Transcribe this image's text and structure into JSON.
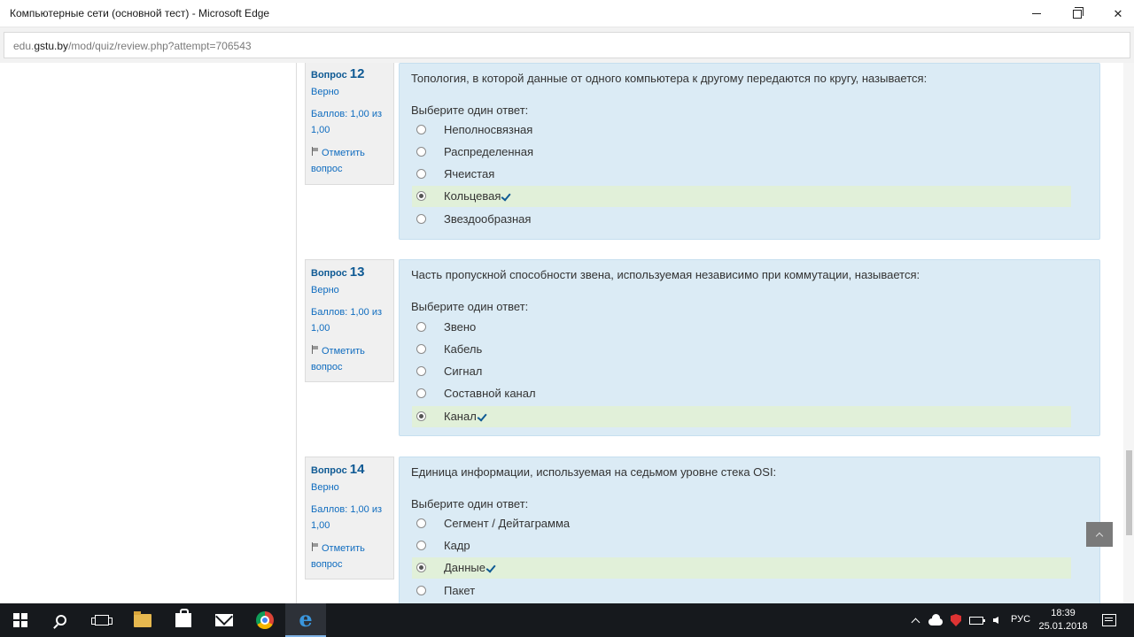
{
  "window": {
    "title": "Компьютерные сети (основной тест) - Microsoft Edge"
  },
  "address": {
    "prefix": "edu.",
    "domain": "gstu.by",
    "path": "/mod/quiz/review.php?attempt=706543"
  },
  "questions": [
    {
      "label": "Вопрос",
      "number": "12",
      "state": "Верно",
      "grade": "Баллов: 1,00 из 1,00",
      "flag": "Отметить вопрос",
      "text": "Топология, в которой данные от одного компьютера к другому передаются по кругу, называется:",
      "prompt": "Выберите один ответ:",
      "options": [
        "Неполносвязная",
        "Распределенная",
        "Ячеистая",
        "Кольцевая",
        "Звездообразная"
      ],
      "selected_index": 3
    },
    {
      "label": "Вопрос",
      "number": "13",
      "state": "Верно",
      "grade": "Баллов: 1,00 из 1,00",
      "flag": "Отметить вопрос",
      "text": "Часть пропускной способности звена, используемая независимо при коммутации, называется:",
      "prompt": "Выберите один ответ:",
      "options": [
        "Звено",
        "Кабель",
        "Сигнал",
        "Составной канал",
        "Канал"
      ],
      "selected_index": 4
    },
    {
      "label": "Вопрос",
      "number": "14",
      "state": "Верно",
      "grade": "Баллов: 1,00 из 1,00",
      "flag": "Отметить вопрос",
      "text": "Единица информации, используемая на седьмом уровне стека OSI:",
      "prompt": "Выберите один ответ:",
      "options": [
        "Сегмент / Дейтаграмма",
        "Кадр",
        "Данные",
        "Пакет"
      ],
      "selected_index": 2
    }
  ],
  "taskbar": {
    "apps": [
      "start-icon",
      "search-icon",
      "task-view-icon",
      "file-explorer-icon",
      "store-icon",
      "mail-icon",
      "chrome-icon",
      "edge-icon"
    ],
    "language": "РУС",
    "time": "18:39",
    "date": "25.01.2018"
  },
  "colors": {
    "question_bg": "#dbebf5",
    "correct_bg": "#e1f0d9",
    "link": "#0f6cbf",
    "taskbar": "#16191d"
  }
}
